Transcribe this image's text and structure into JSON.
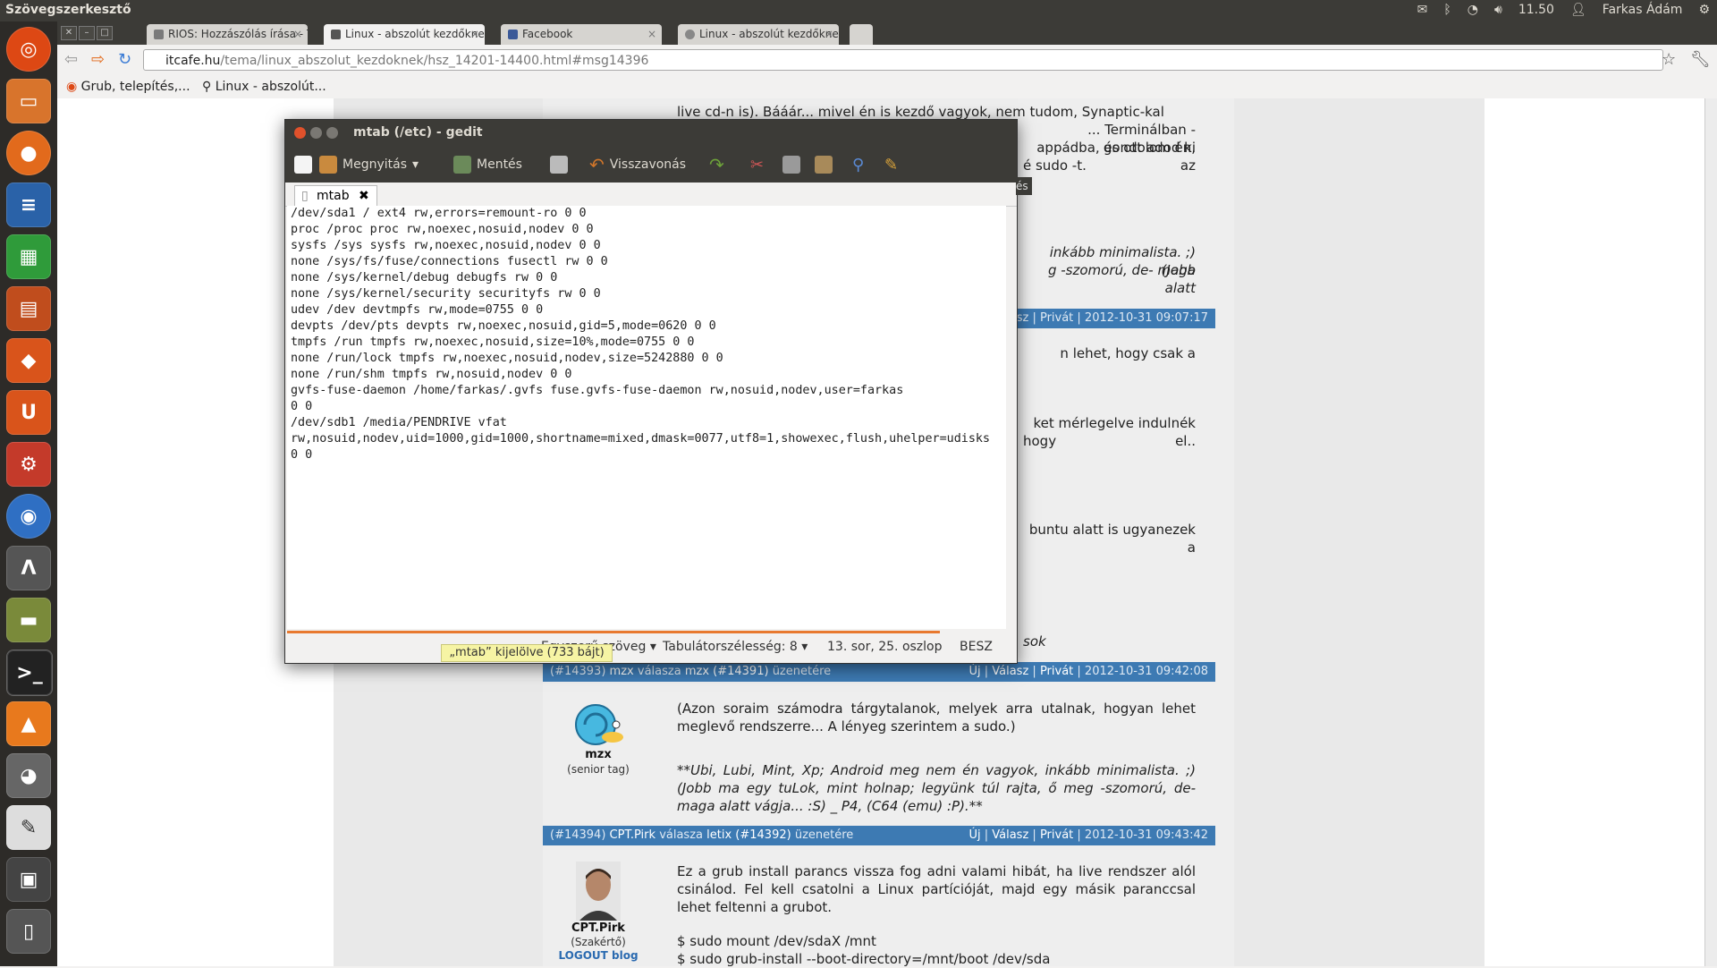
{
  "top_panel": {
    "app_title": "Szövegszerkesztő",
    "tray": {
      "time": "11.50",
      "user": "Farkas Ádám",
      "icons": [
        "mail-icon",
        "bluetooth-icon",
        "wifi-icon",
        "volume-icon",
        "user-icon",
        "gear-icon"
      ]
    }
  },
  "launcher": {
    "items": [
      "ubuntu-dash",
      "files",
      "firefox",
      "writer",
      "calc",
      "impress",
      "software-center",
      "ubuntu-one",
      "system-settings",
      "chromium",
      "inkscape",
      "scanner",
      "terminal",
      "vlc",
      "gimp",
      "gedit",
      "workspaces",
      "usb-drive"
    ]
  },
  "browser": {
    "tabs": [
      {
        "label": "RIOS: Hozzászólás írása - T",
        "active": false
      },
      {
        "label": "Linux - abszolút kezdőkne",
        "active": true
      },
      {
        "label": "Facebook",
        "active": false
      },
      {
        "label": "Linux - abszolút kezdőkne",
        "active": false
      }
    ],
    "url_host": "itcafe.hu",
    "url_path": "/tema/linux_abszolut_kezdoknek/hsz_14201-14400.html#msg14396",
    "bookmarks": [
      {
        "label": "Grub, telepítés,..."
      },
      {
        "label": "Linux - abszolút..."
      }
    ]
  },
  "page": {
    "fragments": {
      "line1": "live cd-n is). Bááár... mivel én is kezdő vagyok, nem tudom, Synaptic-kal",
      "line2": "... Terminálban -gondolom én,",
      "line3": "appádba, és ott adod ki az",
      "line4": "é sudo -t.",
      "line5": "inkább minimalista. ;) (Jobb",
      "line6": "g -szomorú, de- maga alatt",
      "header_frag": "sz | Privát | 2012-10-31 09:07:17",
      "line7": "n lehet, hogy csak a",
      "line8": "ket mérlegelve indulnék el..",
      "line9": "hogy",
      "line10": "buntu alatt is ugyanezek a",
      "line11": "sok",
      "es": "és"
    },
    "posts": [
      {
        "id": "(#14393)",
        "author": "mzx",
        "reply_word": "válasza",
        "reply_to": "mzx (#14391)",
        "msg_word": "üzenetére",
        "actions": [
          "Új",
          "Válasz",
          "Privát"
        ],
        "timestamp": "2012-10-31 09:42:08",
        "avatar_name": "mzx",
        "avatar_rank": "(senior tag)",
        "body": "(Azon soraim számodra tárgytalanok, melyek arra utalnak, hogyan lehet meglevő rendszerre... A lényeg szerintem a sudo.)",
        "signature": "**Ubi, Lubi, Mint, Xp; Android meg nem én vagyok, inkább minimalista. ;) (Jobb ma egy tuLok, mint holnap; legyünk túl rajta, ő meg -szomorú, de- maga alatt vágja... :S) _ P4, (C64 (emu) :P).**"
      },
      {
        "id": "(#14394)",
        "author": "CPT.Pirk",
        "reply_word": "válasza",
        "reply_to": "letix (#14392)",
        "msg_word": "üzenetére",
        "actions": [
          "Új",
          "Válasz",
          "Privát"
        ],
        "timestamp": "2012-10-31 09:43:42",
        "avatar_name": "CPT.Pirk",
        "avatar_rank": "(Szakértő)",
        "avatar_link": "LOGOUT blog",
        "body": "Ez a grub install parancs vissza fog adni valami hibát, ha live rendszer alól csinálod. Fel kell csatolni a Linux partícióját, majd egy másik paranccsal lehet feltenni a grubot.",
        "cmd1": "$ sudo mount /dev/sdaX /mnt",
        "cmd2": "$ sudo grub-install --boot-directory=/mnt/boot /dev/sda"
      }
    ]
  },
  "gedit": {
    "title": "mtab (/etc) - gedit",
    "toolbar": {
      "open_label": "Megnyitás",
      "save_label": "Mentés",
      "undo_label": "Visszavonás"
    },
    "tab_label": "mtab",
    "lines": [
      "/dev/sda1 / ext4 rw,errors=remount-ro 0 0",
      "proc /proc proc rw,noexec,nosuid,nodev 0 0",
      "sysfs /sys sysfs rw,noexec,nosuid,nodev 0 0",
      "none /sys/fs/fuse/connections fusectl rw 0 0",
      "none /sys/kernel/debug debugfs rw 0 0",
      "none /sys/kernel/security securityfs rw 0 0",
      "udev /dev devtmpfs rw,mode=0755 0 0",
      "devpts /dev/pts devpts rw,noexec,nosuid,gid=5,mode=0620 0 0",
      "tmpfs /run tmpfs rw,noexec,nosuid,size=10%,mode=0755 0 0",
      "none /run/lock tmpfs rw,noexec,nosuid,nodev,size=5242880 0 0",
      "none /run/shm tmpfs rw,nosuid,nodev 0 0",
      "gvfs-fuse-daemon /home/farkas/.gvfs fuse.gvfs-fuse-daemon rw,nosuid,nodev,user=farkas",
      "0 0",
      "/dev/sdb1 /media/PENDRIVE vfat",
      "rw,nosuid,nodev,uid=1000,gid=1000,shortname=mixed,dmask=0077,utf8=1,showexec,flush,uhelper=udisks",
      "0 0"
    ],
    "status": {
      "syntax": "Egyszerű szöveg",
      "tab_width": "Tabulátorszélesség: 8",
      "position": "13. sor, 25. oszlop",
      "mode": "BESZ"
    },
    "tooltip": "„mtab” kijelölve (733 bájt)"
  },
  "colors": {
    "panel": "#3c3b37",
    "launcher": "#2d2b28",
    "post_header": "#3d7ab3",
    "accent_orange": "#e8792f"
  }
}
